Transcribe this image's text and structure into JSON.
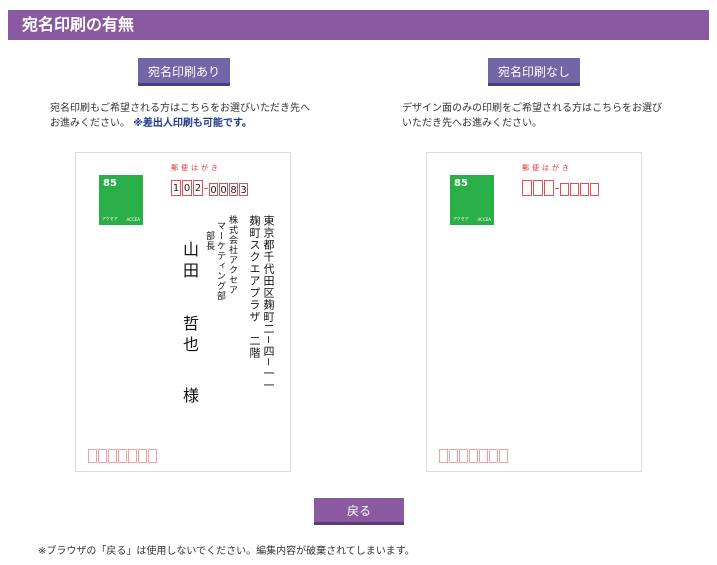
{
  "header": {
    "title": "宛名印刷の有無"
  },
  "with_print": {
    "button_label": "宛名印刷あり",
    "desc_line1": "宛名印刷もご希望される方はこちらをお選びいただき先へ",
    "desc_line2": "お進みください。",
    "desc_note": "※差出人印刷も可能です。",
    "card": {
      "title": "郵便はがき",
      "stamp_value": "85",
      "stamp_left": "アクセア",
      "stamp_right": "ACCEA",
      "postal_digits": [
        "1",
        "0",
        "2",
        "0",
        "0",
        "8",
        "3"
      ],
      "address_line1": "東京都千代田区麹町二−四−一一",
      "address_line2": "麹町スクエアプラザ　二階",
      "company": "株式会社アクセア",
      "department": "マーケティング部",
      "title_role": "部長",
      "surname": "山田",
      "given_name": "哲也",
      "honorific": "様"
    }
  },
  "without_print": {
    "button_label": "宛名印刷なし",
    "desc_line1": "デザイン面のみの印刷をご希望される方はこちらをお選び",
    "desc_line2": "いただき先へお進みください。",
    "card": {
      "title": "郵便はがき",
      "stamp_value": "85",
      "stamp_left": "アクセア",
      "stamp_right": "ACCEA"
    }
  },
  "back_button": {
    "label": "戻る"
  },
  "footnote": "※ブラウザの「戻る」は使用しないでください。編集内容が破棄されてしまいます。",
  "colors": {
    "header": "#8a5aa0",
    "option_button": "#7266a6",
    "stamp": "#2aae48",
    "postal_box": "#e05050"
  }
}
